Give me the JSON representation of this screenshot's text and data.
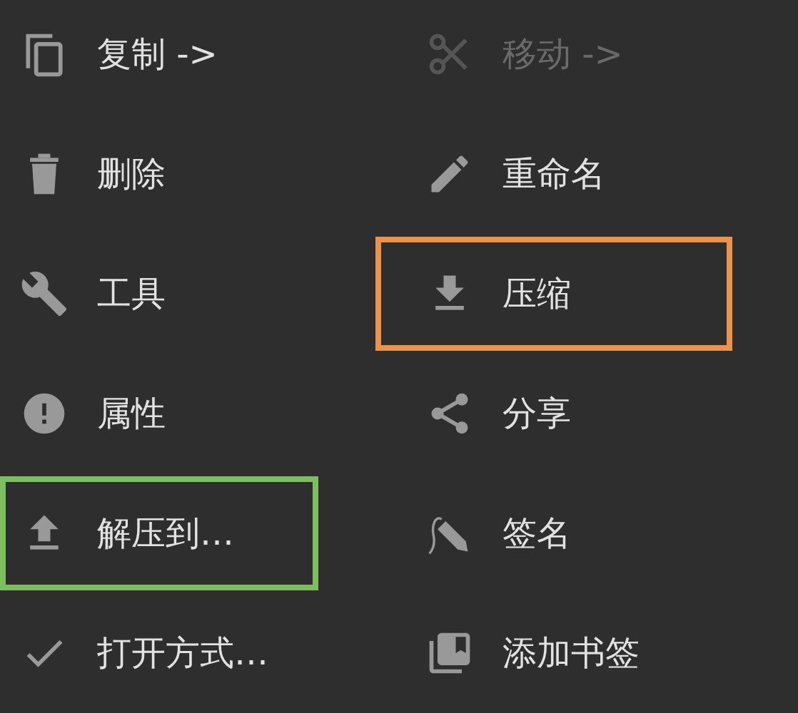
{
  "menu": {
    "items": [
      {
        "label": "复制 ->",
        "disabled": false
      },
      {
        "label": "移动 ->",
        "disabled": true
      },
      {
        "label": "删除",
        "disabled": false
      },
      {
        "label": "重命名",
        "disabled": false
      },
      {
        "label": "工具",
        "disabled": false
      },
      {
        "label": "压缩",
        "disabled": false,
        "color": "#ec924a"
      },
      {
        "label": "属性",
        "disabled": false
      },
      {
        "label": "分享",
        "disabled": false
      },
      {
        "label": "解压到…",
        "disabled": false,
        "color": "#7dbe5e"
      },
      {
        "label": "签名",
        "disabled": false
      },
      {
        "label": "打开方式…",
        "disabled": false
      },
      {
        "label": "添加书签",
        "disabled": false
      }
    ]
  }
}
